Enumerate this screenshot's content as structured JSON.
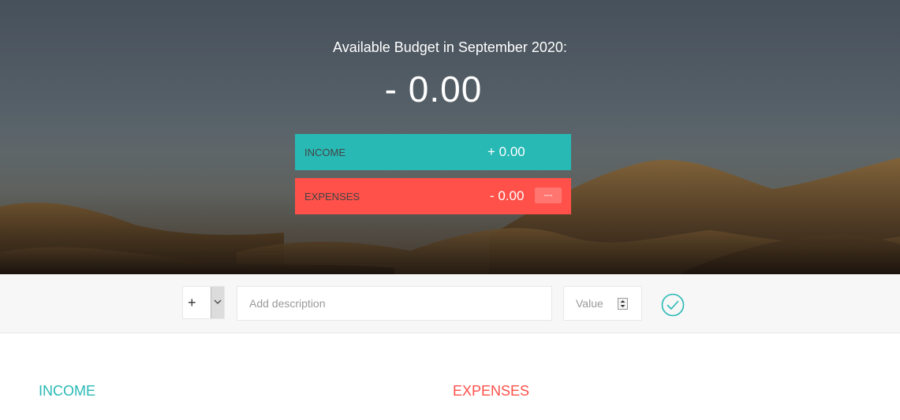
{
  "hero": {
    "title": "Available Budget in September 2020:",
    "budget_value": "- 0.00",
    "income": {
      "label": "Income",
      "amount": "+ 0.00",
      "color": "#28b9b5"
    },
    "expenses": {
      "label": "Expenses",
      "amount": "- 0.00",
      "percentage": "---",
      "color": "#ff5049"
    }
  },
  "add_form": {
    "type_value": "+",
    "type_options": [
      "+",
      "-"
    ],
    "description_placeholder": "Add description",
    "value_placeholder": "Value",
    "submit_icon": "check-circle-icon"
  },
  "lists": {
    "income_title": "INCOME",
    "expenses_title": "EXPENSES"
  },
  "colors": {
    "income": "#28b9b5",
    "expense": "#ff5049",
    "input_bar_bg": "#f7f7f7"
  }
}
